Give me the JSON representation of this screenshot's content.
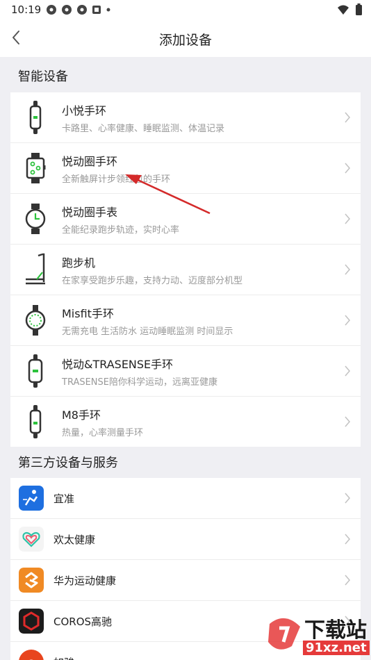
{
  "status": {
    "time": "10:19"
  },
  "nav": {
    "title": "添加设备"
  },
  "sections": {
    "smart": "智能设备",
    "third": "第三方设备与服务"
  },
  "devices": [
    {
      "name": "小悦手环",
      "desc": "卡路里、心率健康、睡眠监测、体温记录",
      "icon": "band-icon"
    },
    {
      "name": "悦动圈手环",
      "desc": "全新触屏计步领红包的手环",
      "icon": "square-watch-icon"
    },
    {
      "name": "悦动圈手表",
      "desc": "全能纪录跑步轨迹，实时心率",
      "icon": "round-watch-icon"
    },
    {
      "name": "跑步机",
      "desc": "在家享受跑步乐趣，支持力动、迈度部分机型",
      "icon": "treadmill-icon"
    },
    {
      "name": "Misfit手环",
      "desc": "无需充电 生活防水 运动睡眠监测 时间显示",
      "icon": "misfit-icon"
    },
    {
      "name": "悦动&TRASENSE手环",
      "desc": "TRASENSE陪你科学运动，远离亚健康",
      "icon": "band-icon"
    },
    {
      "name": "M8手环",
      "desc": "热量，心率测量手环",
      "icon": "band-icon"
    }
  ],
  "services": [
    {
      "name": "宜准",
      "color": "#1e6fe0"
    },
    {
      "name": "欢太健康",
      "color": "#f4f4f4"
    },
    {
      "name": "华为运动健康",
      "color": "#f08a24"
    },
    {
      "name": "COROS高驰",
      "color": "#1c1c1c"
    },
    {
      "name": "如骏",
      "color": "#e8451e"
    }
  ],
  "watermark": {
    "text": "下载站",
    "url": "91xz.net"
  },
  "colors": {
    "accent": "#2cc23c",
    "arrow": "#d42a2a"
  }
}
